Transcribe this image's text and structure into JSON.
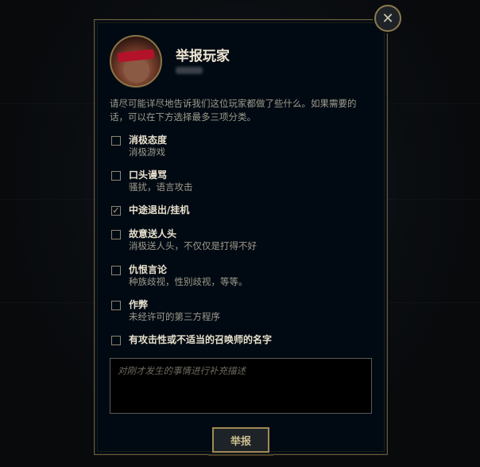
{
  "dialog": {
    "title": "举报玩家",
    "description": "请尽可能详尽地告诉我们这位玩家都做了些什么。如果需要的话，可以在下方选择最多三项分类。",
    "close_label": "✕"
  },
  "options": [
    {
      "label": "消极态度",
      "sub": "消极游戏",
      "checked": false
    },
    {
      "label": "口头谩骂",
      "sub": "骚扰，语言攻击",
      "checked": false
    },
    {
      "label": "中途退出/挂机",
      "sub": "",
      "checked": true
    },
    {
      "label": "故意送人头",
      "sub": "消极送人头，不仅仅是打得不好",
      "checked": false
    },
    {
      "label": "仇恨言论",
      "sub": "种族歧视，性别歧视，等等。",
      "checked": false
    },
    {
      "label": "作弊",
      "sub": "未经许可的第三方程序",
      "checked": false
    },
    {
      "label": "有攻击性或不适当的召唤师的名字",
      "sub": "",
      "checked": false
    }
  ],
  "comment": {
    "placeholder": "对刚才发生的事情进行补充描述",
    "value": ""
  },
  "submit": {
    "label": "举报"
  },
  "colors": {
    "gold": "#c8aa6e",
    "panel": "#010a13",
    "text": "#a09b8c"
  }
}
